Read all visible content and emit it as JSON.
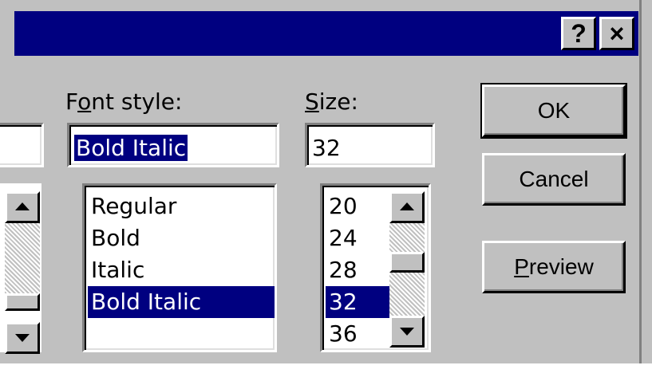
{
  "titlebar": {
    "help_label": "?",
    "close_label": "×"
  },
  "font_style": {
    "label_pre": "F",
    "label_accel": "o",
    "label_post": "nt style:",
    "value": "Bold Italic",
    "options": [
      "Regular",
      "Bold",
      "Italic",
      "Bold Italic"
    ],
    "selected": "Bold Italic"
  },
  "size": {
    "label_accel": "S",
    "label_post": "ize:",
    "value": "32",
    "options": [
      "20",
      "24",
      "28",
      "32",
      "36"
    ],
    "selected": "32"
  },
  "buttons": {
    "ok": "OK",
    "cancel": "Cancel",
    "preview_accel": "P",
    "preview_post": "review"
  },
  "colors": {
    "title_bar": "#000080",
    "face": "#c0c0c0",
    "highlight": "#000080"
  }
}
